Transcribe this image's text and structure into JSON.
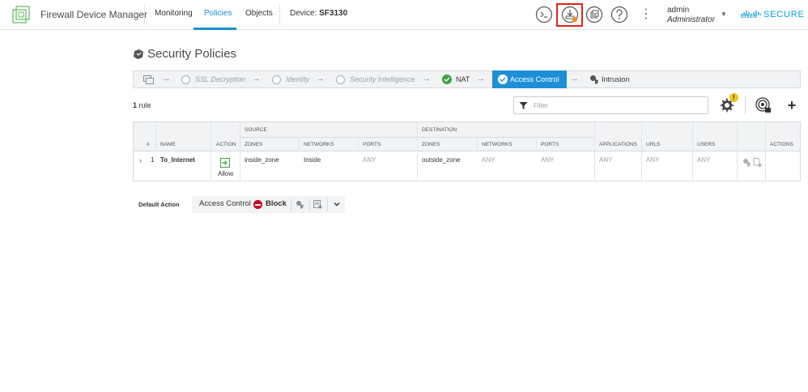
{
  "header": {
    "app_title": "Firewall Device Manager",
    "nav": [
      {
        "label": "Monitoring",
        "active": false
      },
      {
        "label": "Policies",
        "active": true
      },
      {
        "label": "Objects",
        "active": false
      }
    ],
    "device_prefix": "Device: ",
    "device_name": "SF3130",
    "icons": [
      "terminal-icon",
      "deployment-icon",
      "task-list-icon",
      "help-icon",
      "more-options-icon"
    ],
    "user_name": "admin",
    "user_role": "Administrator",
    "brand_cisco": "cisco",
    "brand_secure": "SECURE",
    "accent_color": "#1e8fd6",
    "highlight_color": "#e0241b"
  },
  "page": {
    "title": "Security Policies"
  },
  "flow": {
    "steps": [
      {
        "label": "SSL Decryption",
        "state": "pending"
      },
      {
        "label": "Identity",
        "state": "pending"
      },
      {
        "label": "Security Intelligence",
        "state": "pending"
      },
      {
        "label": "NAT",
        "state": "done"
      },
      {
        "label": "Access Control",
        "state": "active"
      },
      {
        "label": "Intrusion",
        "state": "normal"
      }
    ]
  },
  "rules": {
    "count": "1",
    "count_suffix": " rule",
    "filter_placeholder": "Filter",
    "warning_badge": "!"
  },
  "table": {
    "group_source": "SOURCE",
    "group_destination": "DESTINATION",
    "headers": {
      "num": "#",
      "name": "NAME",
      "action": "ACTION",
      "src_zones": "ZONES",
      "src_networks": "NETWORKS",
      "src_ports": "PORTS",
      "dst_zones": "ZONES",
      "dst_networks": "NETWORKS",
      "dst_ports": "PORTS",
      "applications": "APPLICATIONS",
      "urls": "URLS",
      "users": "USERS",
      "actions": "ACTIONS"
    },
    "rows": [
      {
        "num": "1",
        "name": "To_Internet",
        "action": "Allow",
        "src_zones": "inside_zone",
        "src_networks": "Inside",
        "src_ports": "ANY",
        "dst_zones": "outside_zone",
        "dst_networks": "ANY",
        "dst_ports": "ANY",
        "applications": "ANY",
        "urls": "ANY",
        "users": "ANY"
      }
    ]
  },
  "default_action": {
    "label": "Default Action",
    "policy": "Access Control",
    "action": "Block"
  }
}
